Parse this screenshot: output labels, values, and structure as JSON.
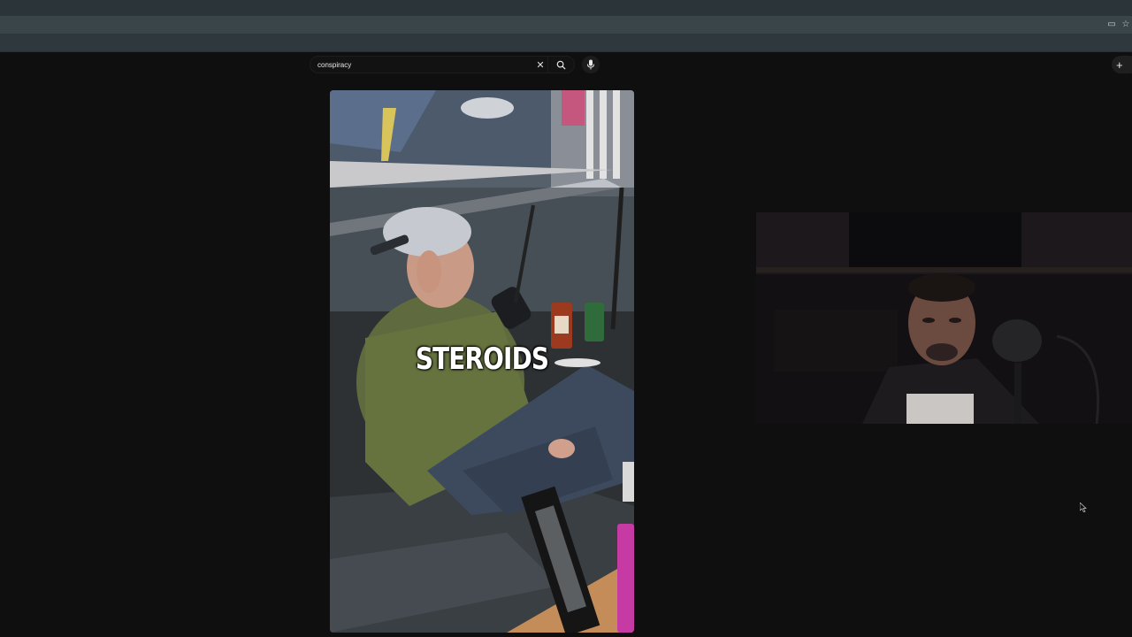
{
  "search": {
    "query": "conspiracy",
    "clear_icon": "close-icon",
    "search_icon": "search-icon",
    "mic_icon": "microphone-icon"
  },
  "header": {
    "create_icon": "plus-icon"
  },
  "short": {
    "caption": "STEROIDS"
  },
  "colors": {
    "page_background": "#0f0f0f",
    "browser_chrome": "#2b3438"
  }
}
